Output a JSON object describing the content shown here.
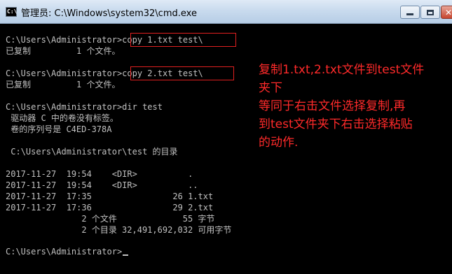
{
  "window": {
    "title": "管理员: C:\\Windows\\system32\\cmd.exe",
    "icon": "cmd-icon",
    "icon_text": "C:\\",
    "buttons": {
      "minimize": "minimize-icon",
      "maximize": "maximize-icon",
      "close": "close-icon",
      "close_glyph": "✕"
    }
  },
  "console": {
    "lines": [
      "C:\\Users\\Administrator>copy 1.txt test\\",
      "已复制         1 个文件。",
      "C:\\Users\\Administrator>copy 2.txt test\\",
      "已复制         1 个文件。",
      "C:\\Users\\Administrator>dir test",
      " 驱动器 C 中的卷没有标签。",
      " 卷的序列号是 C4ED-378A",
      " C:\\Users\\Administrator\\test 的目录",
      "2017-11-27  19:54    <DIR>          .",
      "2017-11-27  19:54    <DIR>          ..",
      "2017-11-27  17:35                26 1.txt",
      "2017-11-27  17:36                29 2.txt",
      "               2 个文件             55 字节",
      "               2 个目录 32,491,692,032 可用字节",
      "C:\\Users\\Administrator>"
    ]
  },
  "annotation": {
    "color": "#ff2a2a",
    "lines": [
      "复制1.txt,2.txt文件到test文件",
      "夹下",
      "等同于右击文件选择复制,再",
      "到test文件夹下右击选择粘贴",
      "的动作."
    ]
  }
}
